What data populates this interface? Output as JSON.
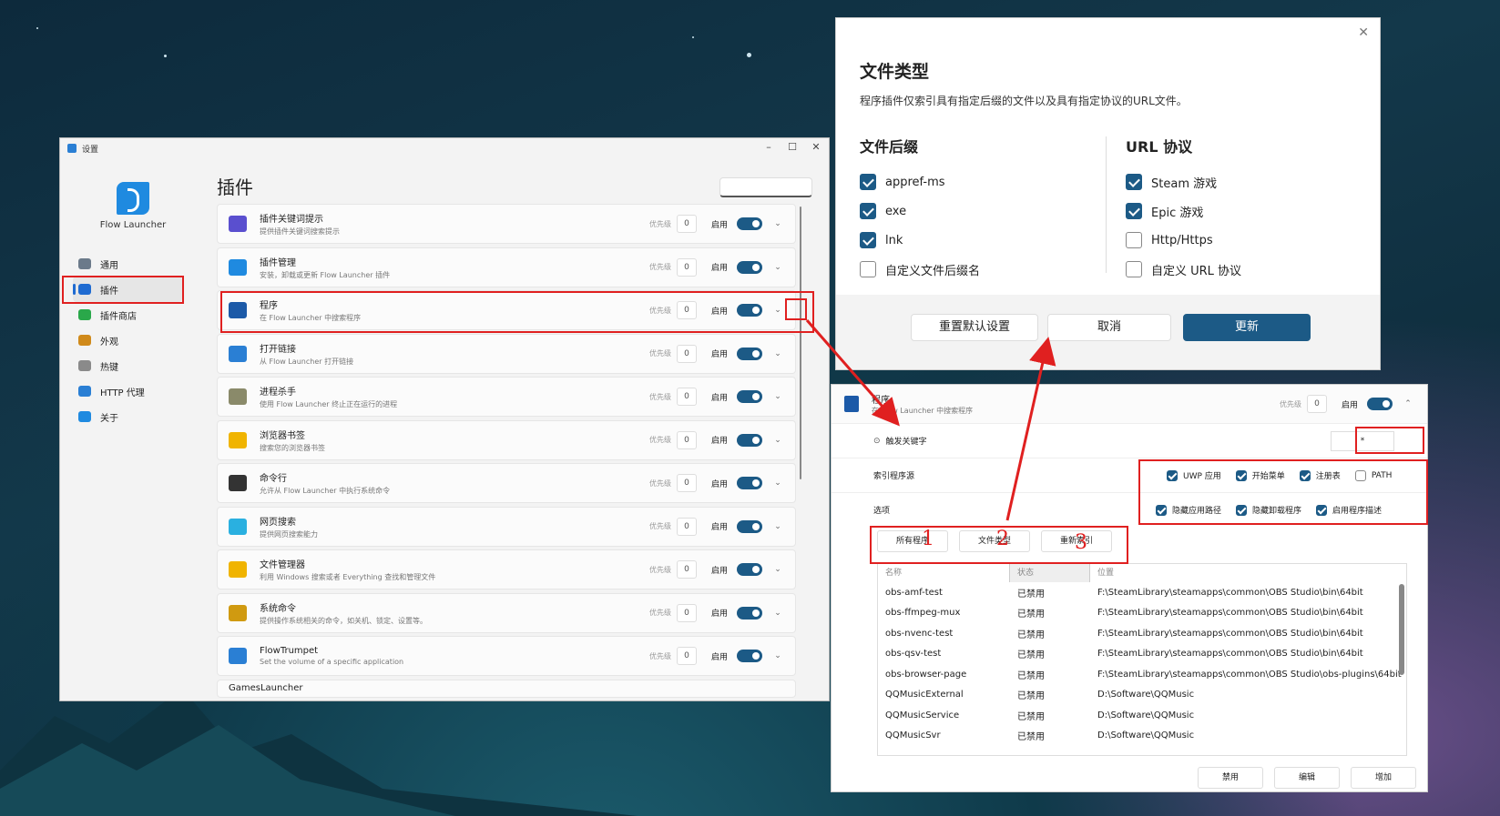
{
  "settings": {
    "title": "设置",
    "brand": "Flow Launcher",
    "nav": [
      {
        "label": "通用",
        "icon": "gear-icon",
        "color": "#6b7a8a"
      },
      {
        "label": "插件",
        "icon": "puzzle-icon",
        "color": "#1f6bd1"
      },
      {
        "label": "插件商店",
        "icon": "store-icon",
        "color": "#2aa84a"
      },
      {
        "label": "外观",
        "icon": "brush-icon",
        "color": "#d08a1a"
      },
      {
        "label": "热键",
        "icon": "keyboard-icon",
        "color": "#8a8a8a"
      },
      {
        "label": "HTTP 代理",
        "icon": "network-icon",
        "color": "#2a7fd4"
      },
      {
        "label": "关于",
        "icon": "info-icon",
        "color": "#1f8ae0"
      }
    ],
    "page_title": "插件",
    "priority_label": "优先级",
    "enable_label": "启用",
    "plugins": [
      {
        "name": "插件关键词提示",
        "desc": "提供插件关键词搜索提示",
        "priority": "0",
        "icon": "keyword-icon",
        "color": "#5a4fcf"
      },
      {
        "name": "插件管理",
        "desc": "安装，卸载或更新 Flow Launcher 插件",
        "priority": "0",
        "icon": "cloud-icon",
        "color": "#1f8ae0"
      },
      {
        "name": "程序",
        "desc": "在 Flow Launcher 中搜索程序",
        "priority": "0",
        "icon": "program-icon",
        "color": "#1c5aa8"
      },
      {
        "name": "打开链接",
        "desc": "从 Flow Launcher 打开链接",
        "priority": "0",
        "icon": "link-icon",
        "color": "#2a7fd4"
      },
      {
        "name": "进程杀手",
        "desc": "使用 Flow Launcher 终止正在运行的进程",
        "priority": "0",
        "icon": "process-icon",
        "color": "#8a8a6a"
      },
      {
        "name": "浏览器书签",
        "desc": "搜索您的浏览器书签",
        "priority": "0",
        "icon": "star-icon",
        "color": "#f0b400"
      },
      {
        "name": "命令行",
        "desc": "允许从 Flow Launcher 中执行系统命令",
        "priority": "0",
        "icon": "terminal-icon",
        "color": "#333333"
      },
      {
        "name": "网页搜索",
        "desc": "提供网页搜索能力",
        "priority": "0",
        "icon": "magnifier-icon",
        "color": "#2ab0e0"
      },
      {
        "name": "文件管理器",
        "desc": "利用 Windows 搜索或者 Everything 查找和管理文件",
        "priority": "0",
        "icon": "folder-icon",
        "color": "#f0b400"
      },
      {
        "name": "系统命令",
        "desc": "提供操作系统相关的命令，如关机、锁定、设置等。",
        "priority": "0",
        "icon": "lock-icon",
        "color": "#d09a10"
      },
      {
        "name": "FlowTrumpet",
        "desc": "Set the volume of a specific application",
        "priority": "0",
        "icon": "volume-icon",
        "color": "#2a7fd4"
      }
    ],
    "partial_next": "GamesLauncher"
  },
  "dialog": {
    "title": "文件类型",
    "subtitle": "程序插件仅索引具有指定后缀的文件以及具有指定协议的URL文件。",
    "suffix_heading": "文件后缀",
    "suffixes": [
      {
        "label": "appref-ms",
        "checked": true
      },
      {
        "label": "exe",
        "checked": true
      },
      {
        "label": "lnk",
        "checked": true
      },
      {
        "label": "自定义文件后缀名",
        "checked": false
      }
    ],
    "url_heading": "URL 协议",
    "protocols": [
      {
        "label": "Steam 游戏",
        "checked": true
      },
      {
        "label": "Epic 游戏",
        "checked": true
      },
      {
        "label": "Http/Https",
        "checked": false
      },
      {
        "label": "自定义 URL 协议",
        "checked": false
      }
    ],
    "reset_label": "重置默认设置",
    "cancel_label": "取消",
    "update_label": "更新"
  },
  "detail": {
    "name": "程序",
    "desc": "在 Flow Launcher 中搜索程序",
    "priority_label": "优先级",
    "priority": "0",
    "enable_label": "启用",
    "trigger_label": "触发关键字",
    "trigger_value": "*",
    "source_label": "索引程序源",
    "sources": [
      {
        "label": "UWP 应用",
        "checked": true
      },
      {
        "label": "开始菜单",
        "checked": true
      },
      {
        "label": "注册表",
        "checked": true
      },
      {
        "label": "PATH",
        "checked": false
      }
    ],
    "options_label": "选项",
    "options": [
      {
        "label": "隐藏应用路径",
        "checked": true
      },
      {
        "label": "隐藏卸载程序",
        "checked": true
      },
      {
        "label": "启用程序描述",
        "checked": true
      }
    ],
    "all_programs_label": "所有程序",
    "file_types_label": "文件类型",
    "reindex_label": "重新索引",
    "columns": [
      "名称",
      "状态",
      "位置"
    ],
    "rows": [
      [
        "obs-amf-test",
        "已禁用",
        "F:\\SteamLibrary\\steamapps\\common\\OBS Studio\\bin\\64bit"
      ],
      [
        "obs-ffmpeg-mux",
        "已禁用",
        "F:\\SteamLibrary\\steamapps\\common\\OBS Studio\\bin\\64bit"
      ],
      [
        "obs-nvenc-test",
        "已禁用",
        "F:\\SteamLibrary\\steamapps\\common\\OBS Studio\\bin\\64bit"
      ],
      [
        "obs-qsv-test",
        "已禁用",
        "F:\\SteamLibrary\\steamapps\\common\\OBS Studio\\bin\\64bit"
      ],
      [
        "obs-browser-page",
        "已禁用",
        "F:\\SteamLibrary\\steamapps\\common\\OBS Studio\\obs-plugins\\64bit"
      ],
      [
        "QQMusicExternal",
        "已禁用",
        "D:\\Software\\QQMusic"
      ],
      [
        "QQMusicService",
        "已禁用",
        "D:\\Software\\QQMusic"
      ],
      [
        "QQMusicSvr",
        "已禁用",
        "D:\\Software\\QQMusic"
      ]
    ],
    "disable_label": "禁用",
    "edit_label": "编辑",
    "add_label": "增加"
  },
  "annotations": [
    "1",
    "2",
    "3"
  ],
  "accent": "#1c5a86",
  "highlight": "#e02020"
}
